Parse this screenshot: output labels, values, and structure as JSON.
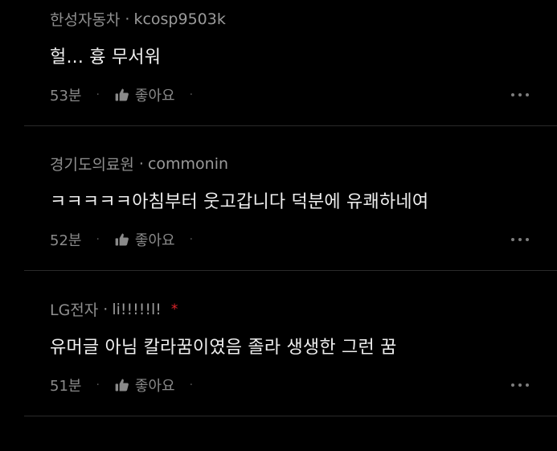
{
  "comments": [
    {
      "company": "한성자동차",
      "username": "kcosp9503k",
      "text": "헐... 흉 무서워",
      "time": "53분",
      "like_label": "좋아요",
      "has_badge": false
    },
    {
      "company": "경기도의료원",
      "username": "commonin",
      "text": "ㅋㅋㅋㅋㅋ아침부터 웃고갑니다 덕분에 유쾌하네여",
      "time": "52분",
      "like_label": "좋아요",
      "has_badge": false
    },
    {
      "company": "LG전자",
      "username": "li!!!!!l!",
      "badge": "*",
      "text": "유머글 아님 칼라꿈이였음 졸라 생생한 그런 꿈",
      "time": "51분",
      "like_label": "좋아요",
      "has_badge": true
    }
  ],
  "separator": "·",
  "icons": {
    "like": "thumbs-up-icon",
    "more": "more-horizontal-icon"
  },
  "colors": {
    "background": "#000000",
    "badge": "#e0252b",
    "text": "#efefef",
    "muted": "#8f8f8f"
  }
}
